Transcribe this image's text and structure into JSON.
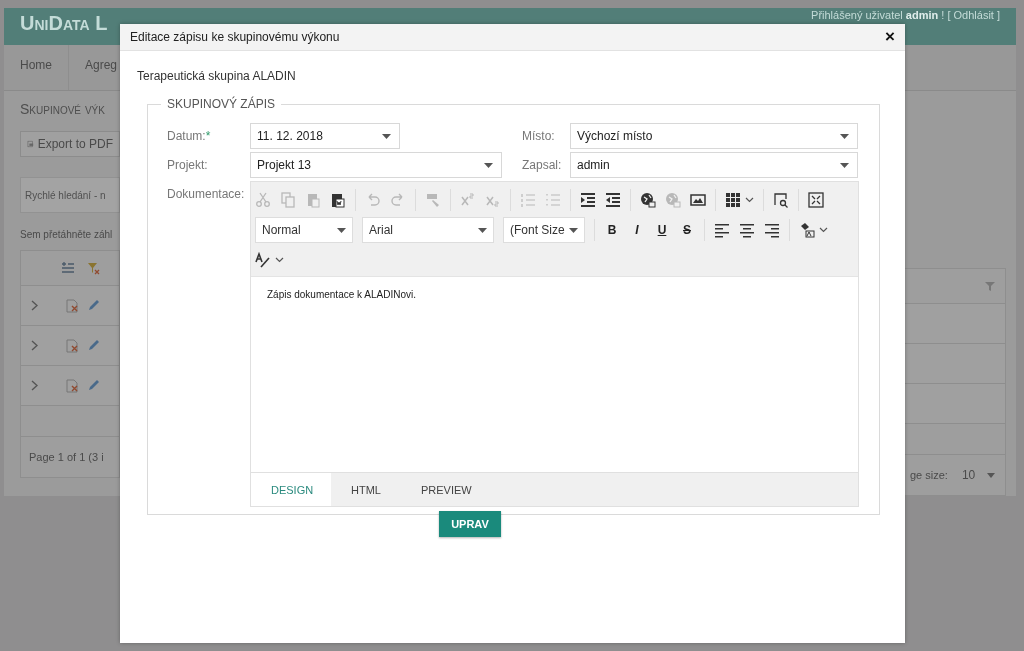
{
  "background": {
    "brand": "UniData L",
    "login": {
      "prefix": "Přihlášený uživatel",
      "user": "admin",
      "suffix": "! [ Odhlásit ]"
    },
    "nav": [
      "Home",
      "Agreg"
    ],
    "page_title": "Skupinové výk",
    "export_button": "Export to PDF",
    "search": {
      "placeholder": "Rychlé hledání - n"
    },
    "group_hint": "Sem přetáhněte záhl",
    "pager": "Page 1 of 1 (3 i",
    "page_size_label": "ge size:",
    "page_size": "10"
  },
  "dialog": {
    "title": "Editace zápisu ke skupinovému výkonu",
    "close": "×",
    "group": "Terapeutická skupina ALADIN",
    "legend": "SKUPINOVÝ ZÁPIS",
    "fields": [
      {
        "label": "Datum:",
        "required_mark": "*",
        "value": "11. 12. 2018"
      },
      {
        "label": "Místo:",
        "value": "Výchozí místo"
      },
      {
        "label": "Projekt:",
        "value": "Projekt 13"
      },
      {
        "label": "Zapsal:",
        "value": "admin"
      }
    ],
    "doc_label": "Dokumentace:",
    "toolbar": [
      [
        {
          "kind": "cut",
          "disabled": true
        },
        {
          "kind": "copy",
          "disabled": true
        },
        {
          "kind": "paste",
          "disabled": true
        },
        {
          "kind": "pasteword",
          "disabled": false
        },
        {
          "kind": "sep"
        },
        {
          "kind": "undo",
          "disabled": true
        },
        {
          "kind": "redo",
          "disabled": true
        },
        {
          "kind": "sep"
        },
        {
          "kind": "painter",
          "disabled": true
        },
        {
          "kind": "sep"
        },
        {
          "kind": "sup",
          "disabled": true
        },
        {
          "kind": "sub",
          "disabled": true
        },
        {
          "kind": "sep"
        },
        {
          "kind": "ol",
          "disabled": true
        },
        {
          "kind": "ul",
          "disabled": true
        },
        {
          "kind": "sep"
        },
        {
          "kind": "indent",
          "disabled": false
        },
        {
          "kind": "outdent",
          "disabled": false
        },
        {
          "kind": "sep"
        },
        {
          "kind": "link",
          "disabled": false
        },
        {
          "kind": "unlink",
          "disabled": true
        },
        {
          "kind": "image",
          "disabled": false
        },
        {
          "kind": "sep"
        },
        {
          "kind": "table",
          "disabled": false
        },
        {
          "kind": "caret"
        },
        {
          "kind": "sep"
        },
        {
          "kind": "find",
          "disabled": false
        },
        {
          "kind": "sep"
        },
        {
          "kind": "fullscreen",
          "disabled": false
        }
      ],
      [
        {
          "kind": "select",
          "value": "Normal"
        },
        {
          "kind": "select",
          "value": "Arial"
        },
        {
          "kind": "select",
          "value": "(Font Size"
        },
        {
          "kind": "sep"
        },
        {
          "kind": "bold",
          "label": "B"
        },
        {
          "kind": "italic",
          "label": "I"
        },
        {
          "kind": "underline",
          "label": "U"
        },
        {
          "kind": "strike",
          "label": "S"
        },
        {
          "kind": "sep"
        },
        {
          "kind": "alignleft",
          "disabled": false
        },
        {
          "kind": "aligncenter",
          "disabled": false
        },
        {
          "kind": "alignright",
          "disabled": false
        },
        {
          "kind": "sep"
        },
        {
          "kind": "color",
          "disabled": false
        },
        {
          "kind": "caret"
        }
      ],
      [
        {
          "kind": "spell",
          "disabled": false
        },
        {
          "kind": "caret"
        }
      ]
    ],
    "content": "Zápis dokumentace k ALADINovi.",
    "tabs": [
      {
        "label": "DESIGN",
        "selected": true
      },
      {
        "label": "HTML",
        "selected": false
      },
      {
        "label": "PREVIEW",
        "selected": false
      }
    ],
    "submit": "UPRAV"
  }
}
